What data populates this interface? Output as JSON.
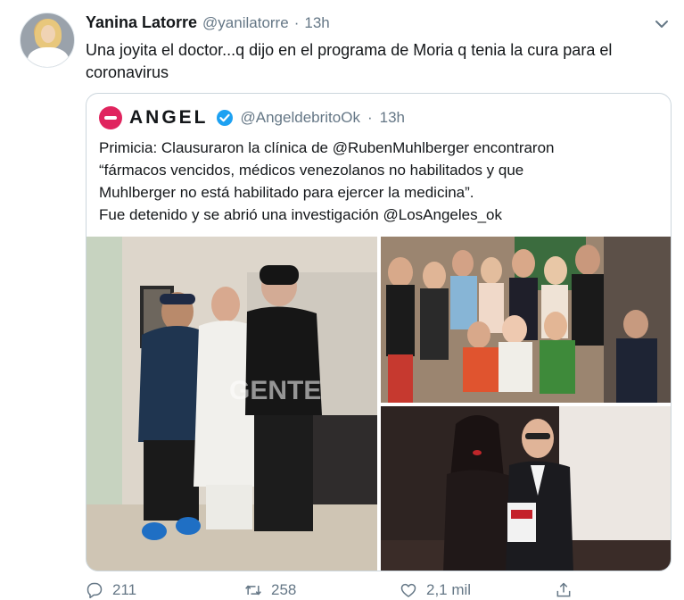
{
  "tweet": {
    "author": {
      "display_name": "Yanina Latorre",
      "handle": "@yanilatorre",
      "separator": "·",
      "time": "13h"
    },
    "text": "Una joyita el doctor...q dijo en el programa de Moria q tenia la cura para el coronavirus",
    "menu_icon": "chevron-down-icon"
  },
  "quote": {
    "author": {
      "display_name": "ANGEL",
      "verified_icon": "verified-badge-icon",
      "handle": "@AngeldebritoOk",
      "separator": "·",
      "time": "13h"
    },
    "text_lines": [
      "Primicia: Clausuraron la clínica de @RubenMuhlberger encontraron",
      "“fármacos vencidos, médicos venezolanos no habilitados y que",
      "Muhlberger no está habilitado para  ejercer la medicina”.",
      "Fue detenido y se abrió una investigación @LosAngeles_ok"
    ],
    "photos": [
      {
        "name": "photo-clinic-group",
        "watermark": "GENTE"
      },
      {
        "name": "photo-party-group"
      },
      {
        "name": "photo-couple-event"
      }
    ]
  },
  "actions": {
    "reply_count": "211",
    "retweet_count": "258",
    "like_count": "2,1 mil",
    "icons": [
      "reply-icon",
      "retweet-icon",
      "like-icon",
      "share-icon"
    ]
  },
  "colors": {
    "text": "#14171a",
    "secondary": "#657786",
    "border": "#ccd6dd",
    "verified": "#1da1f2",
    "angel_brand": "#e0245e"
  }
}
